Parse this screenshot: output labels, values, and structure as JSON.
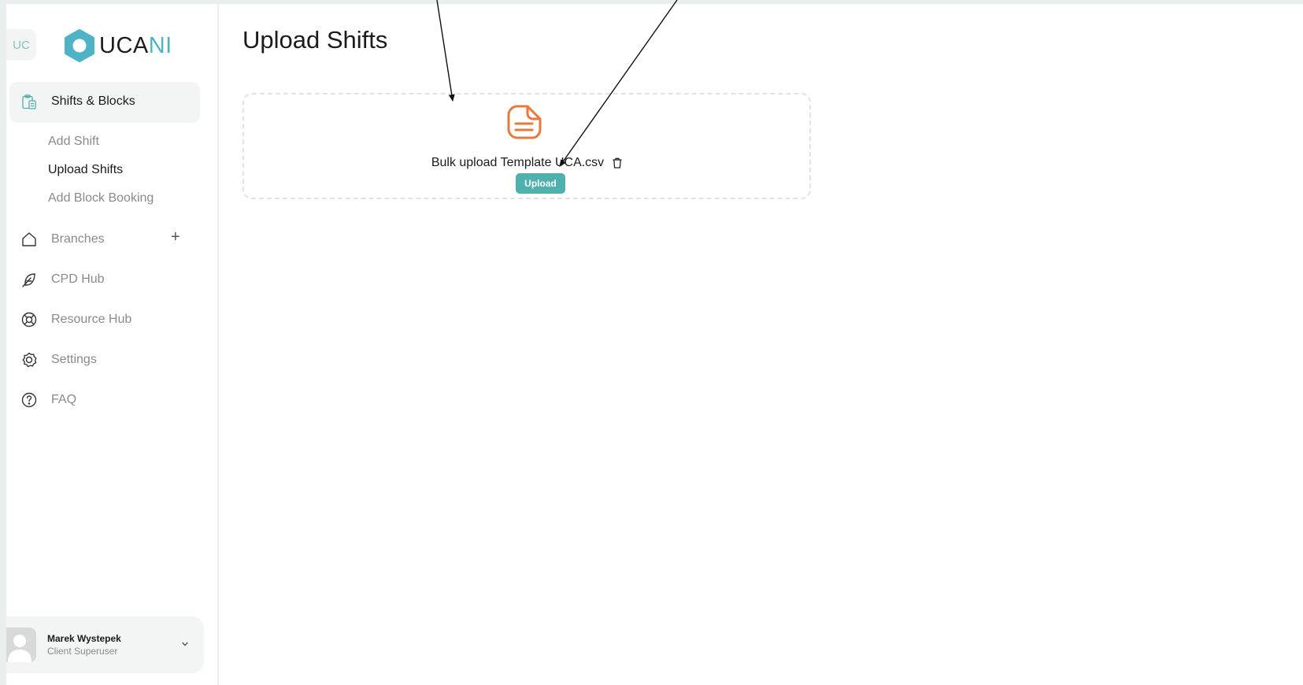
{
  "sidebar": {
    "org_badge": "UC",
    "logo": {
      "text_main": "UCA",
      "text_accent": "NI",
      "mark_color": "#4fb3c6"
    },
    "active_section": {
      "label": "Shifts & Blocks",
      "icon": "clipboard-icon"
    },
    "sub_items": [
      {
        "label": "Add Shift",
        "current": false
      },
      {
        "label": "Upload Shifts",
        "current": true
      },
      {
        "label": "Add Block Booking",
        "current": false
      }
    ],
    "items": [
      {
        "label": "Branches",
        "icon": "home-icon",
        "action": "+"
      },
      {
        "label": "CPD Hub",
        "icon": "feather-icon"
      },
      {
        "label": "Resource Hub",
        "icon": "lifebuoy-icon"
      },
      {
        "label": "Settings",
        "icon": "gear-icon"
      },
      {
        "label": "FAQ",
        "icon": "question-icon"
      }
    ],
    "user": {
      "name": "Marek Wystepek",
      "role": "Client Superuser"
    }
  },
  "main": {
    "title": "Upload Shifts",
    "dropzone": {
      "file_name": "Bulk upload Template UCA.csv",
      "upload_label": "Upload",
      "file_icon_color": "#e8793a",
      "button_color": "#4fb1ad"
    }
  }
}
